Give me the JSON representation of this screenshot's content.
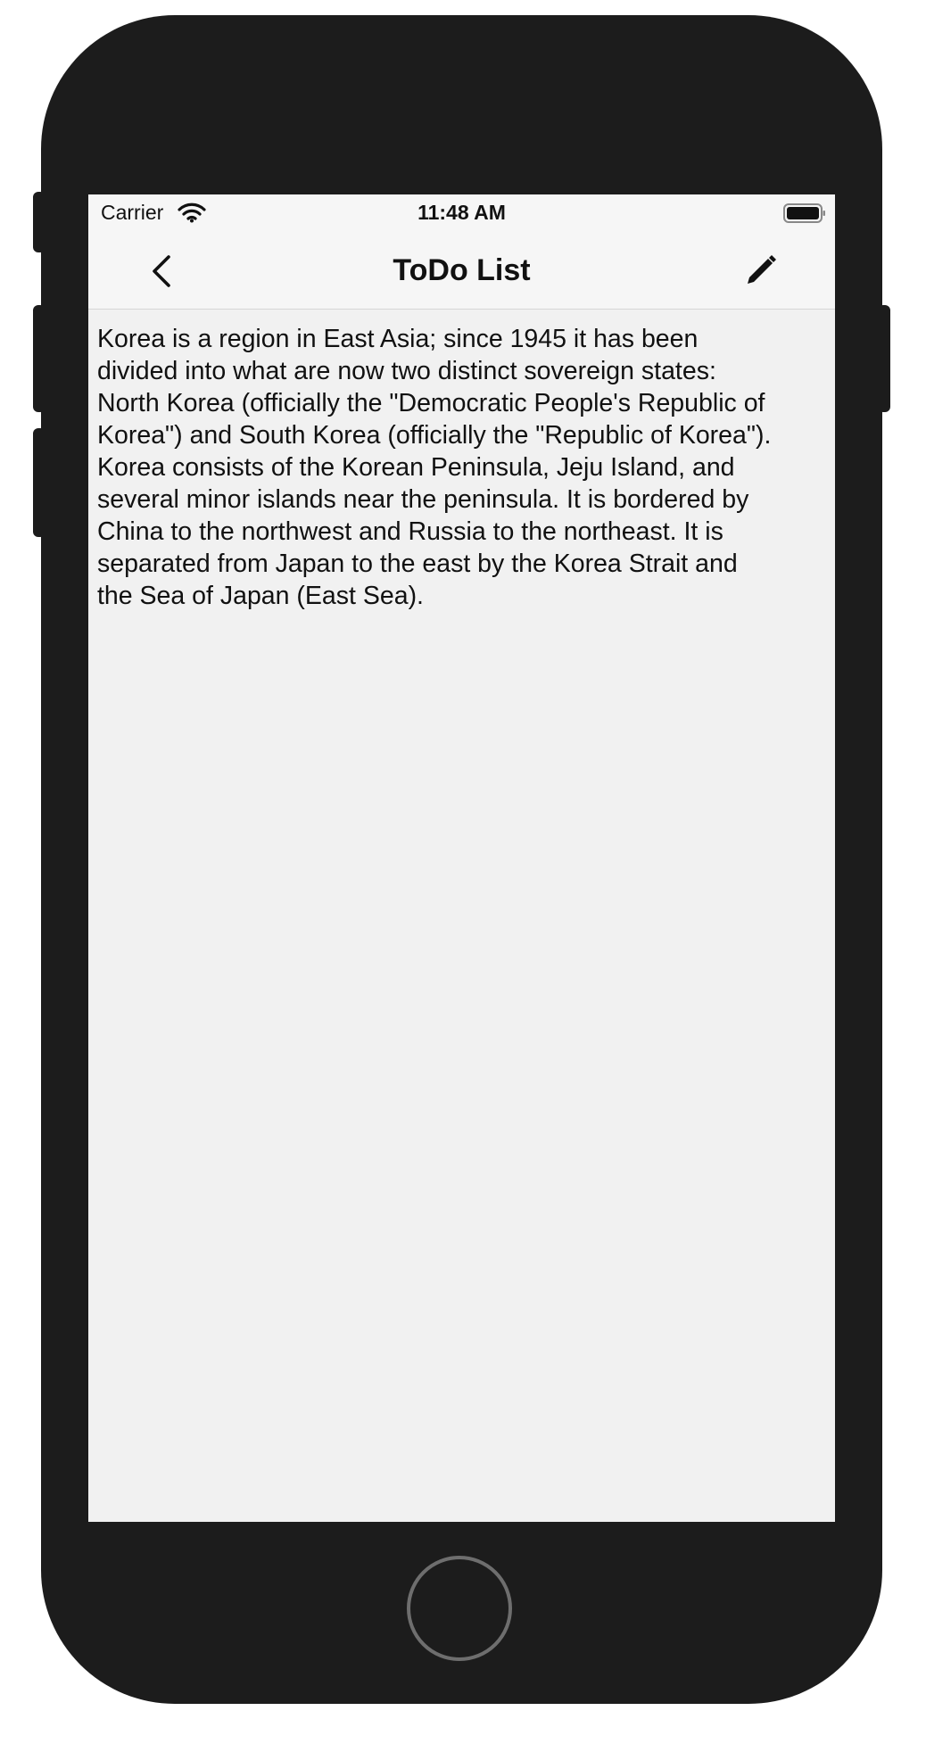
{
  "status_bar": {
    "carrier": "Carrier",
    "time": "11:48 AM",
    "wifi_icon": "wifi-icon",
    "battery_icon": "battery-full-icon"
  },
  "nav_bar": {
    "title": "ToDo List",
    "back_icon": "chevron-left-icon",
    "edit_icon": "pencil-icon"
  },
  "content": {
    "text": "Korea is a region in East Asia; since 1945 it has been\ndivided into what are now two distinct sovereign states:\nNorth Korea (officially the \"Democratic People's Republic of\nKorea\") and South Korea (officially the \"Republic of Korea\").\nKorea consists of the Korean Peninsula, Jeju Island, and\nseveral minor islands near the peninsula. It is bordered by\nChina to the northwest and Russia to the northeast. It is\nseparated from Japan to the east by the Korea Strait and\nthe Sea of Japan (East Sea)."
  },
  "device": {
    "frame_color": "#1c1c1c",
    "screen_background": "#f1f1f1"
  }
}
